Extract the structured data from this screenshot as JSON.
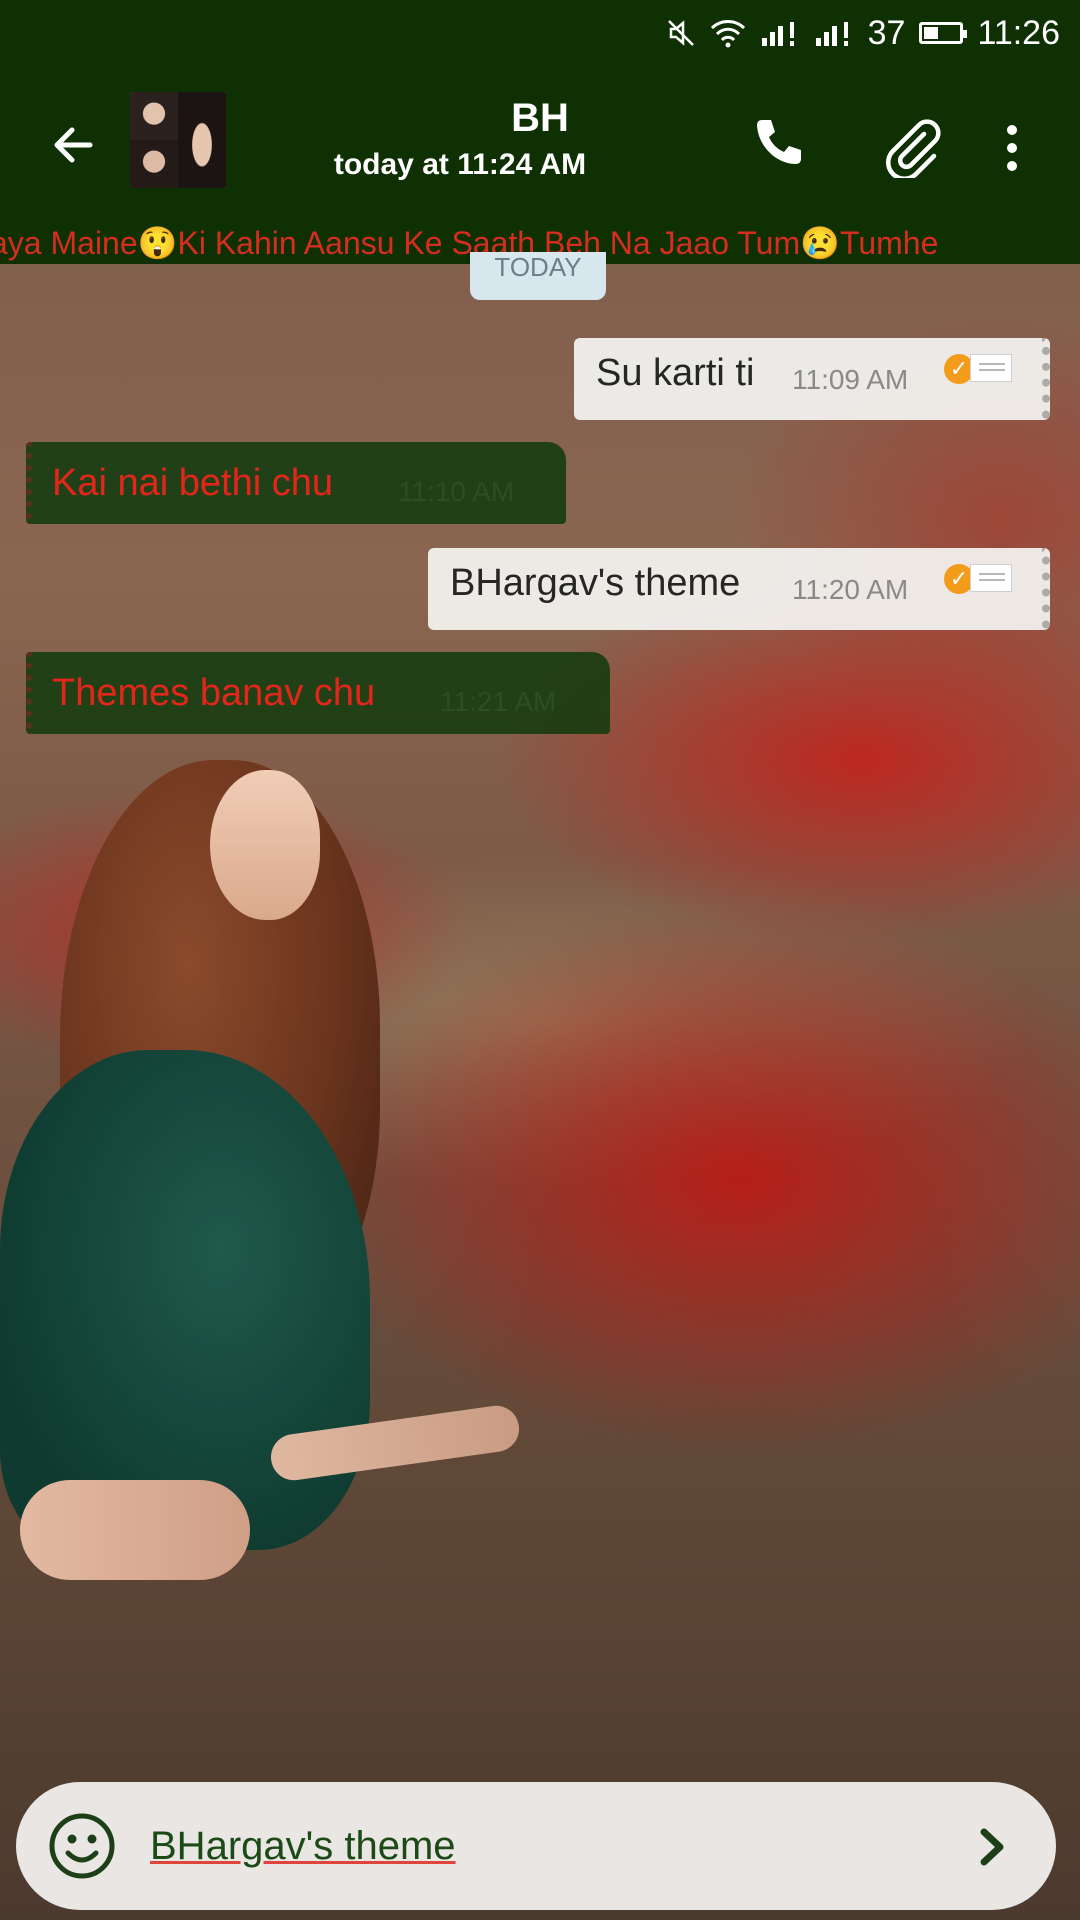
{
  "status_bar": {
    "battery_level": "37",
    "time": "11:26"
  },
  "header": {
    "contact_name": "BH",
    "last_seen": "today at 11:24 AM"
  },
  "marquee_text": "aya Maine😲Ki Kahin Aansu Ke Saath Beh Na Jaao Tum😢Tumhe",
  "date_chip": "TODAY",
  "messages": [
    {
      "direction": "out",
      "text": "Su karti ti",
      "time": "11:09 AM"
    },
    {
      "direction": "in",
      "text": "Kai nai bethi chu",
      "time": "11:10 AM"
    },
    {
      "direction": "out",
      "text": "BHargav's theme",
      "time": "11:20 AM"
    },
    {
      "direction": "in",
      "text": "Themes banav chu",
      "time": "11:21 AM"
    }
  ],
  "composer": {
    "value": "BHargav's theme"
  },
  "colors": {
    "header_bg": "#0e3003",
    "incoming_bubble": "#123a0e",
    "incoming_text": "#e3261a",
    "outgoing_bubble": "#f5f5f3",
    "read_tick": "#f39b1a"
  },
  "icons": [
    "muted-icon",
    "wifi-icon",
    "signal-icon",
    "battery-icon",
    "back-arrow-icon",
    "phone-icon",
    "paperclip-icon",
    "more-vertical-icon",
    "smiley-icon",
    "send-chevron-icon",
    "read-tick-icon",
    "note-icon"
  ]
}
